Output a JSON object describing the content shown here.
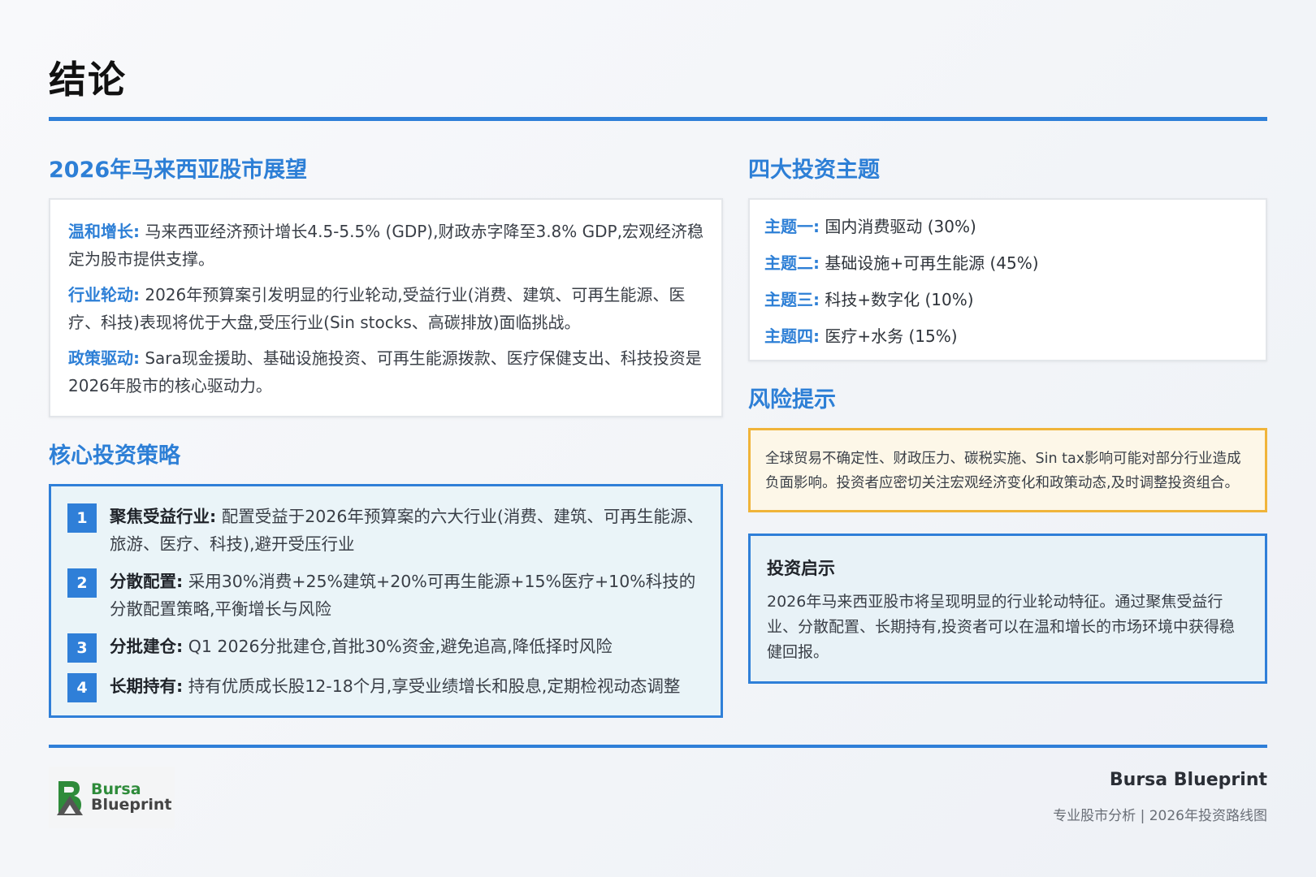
{
  "page": {
    "title": "结论"
  },
  "outlook": {
    "heading": "2026年马来西亚股市展望",
    "paragraphs": [
      {
        "lead": "温和增长:",
        "text": " 马来西亚经济预计增长4.5-5.5% (GDP),财政赤字降至3.8% GDP,宏观经济稳定为股市提供支撑。"
      },
      {
        "lead": "行业轮动:",
        "text": " 2026年预算案引发明显的行业轮动,受益行业(消费、建筑、可再生能源、医疗、科技)表现将优于大盘,受压行业(Sin stocks、高碳排放)面临挑战。"
      },
      {
        "lead": "政策驱动:",
        "text": " Sara现金援助、基础设施投资、可再生能源拨款、医疗保健支出、科技投资是2026年股市的核心驱动力。"
      }
    ]
  },
  "strategy": {
    "heading": "核心投资策略",
    "steps": [
      {
        "num": "1",
        "lead": "聚焦受益行业:",
        "text": " 配置受益于2026年预算案的六大行业(消费、建筑、可再生能源、旅游、医疗、科技),避开受压行业"
      },
      {
        "num": "2",
        "lead": "分散配置:",
        "text": " 采用30%消费+25%建筑+20%可再生能源+15%医疗+10%科技的分散配置策略,平衡增长与风险"
      },
      {
        "num": "3",
        "lead": "分批建仓:",
        "text": " Q1 2026分批建仓,首批30%资金,避免追高,降低择时风险"
      },
      {
        "num": "4",
        "lead": "长期持有:",
        "text": " 持有优质成长股12-18个月,享受业绩增长和股息,定期检视动态调整"
      }
    ]
  },
  "themes": {
    "heading": "四大投资主题",
    "items": [
      {
        "lead": "主题一:",
        "text": " 国内消费驱动 (30%)"
      },
      {
        "lead": "主题二:",
        "text": " 基础设施+可再生能源 (45%)"
      },
      {
        "lead": "主题三:",
        "text": " 科技+数字化 (10%)"
      },
      {
        "lead": "主题四:",
        "text": " 医疗+水务 (15%)"
      }
    ]
  },
  "risk": {
    "heading": "风险提示",
    "text": "全球贸易不确定性、财政压力、碳税实施、Sin tax影响可能对部分行业造成负面影响。投资者应密切关注宏观经济变化和政策动态,及时调整投资组合。"
  },
  "insight": {
    "title": "投资启示",
    "text": "2026年马来西亚股市将呈现明显的行业轮动特征。通过聚焦受益行业、分散配置、长期持有,投资者可以在温和增长的市场环境中获得稳健回报。"
  },
  "footer": {
    "logo_line1": "Bursa",
    "logo_line2": "Blueprint",
    "brand": "Bursa Blueprint",
    "subtitle": "专业股市分析 | 2026年投资路线图"
  },
  "colors": {
    "accent_blue": "#2f7fd8",
    "risk_orange": "#f0b43a",
    "logo_green": "#2e8b3a"
  }
}
